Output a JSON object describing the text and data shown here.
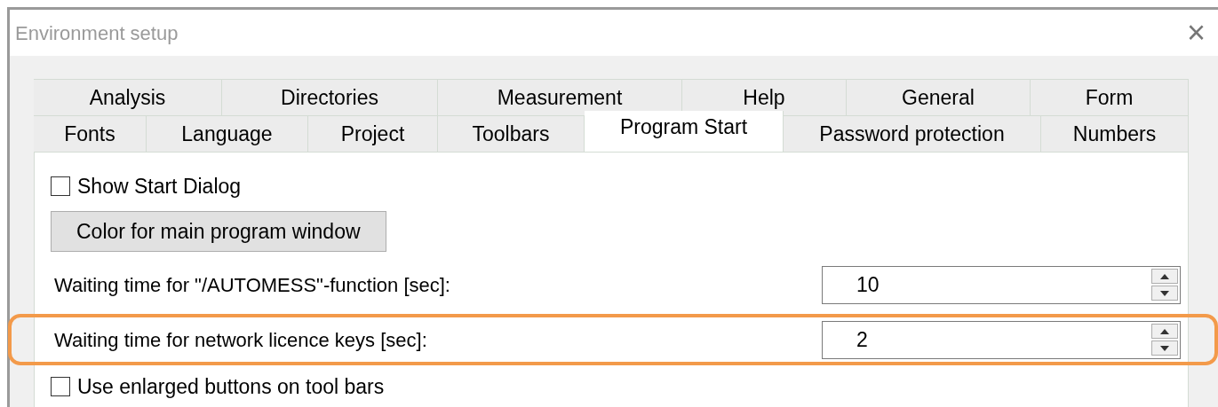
{
  "window": {
    "title": "Environment setup",
    "close": "×"
  },
  "tab_rows": [
    {
      "tabs": [
        {
          "label": "Analysis",
          "selected": false
        },
        {
          "label": "Directories",
          "selected": false
        },
        {
          "label": "Measurement",
          "selected": false
        },
        {
          "label": "Help",
          "selected": false
        },
        {
          "label": "General",
          "selected": false
        },
        {
          "label": "Form",
          "selected": false
        }
      ]
    },
    {
      "tabs": [
        {
          "label": "Fonts",
          "selected": false
        },
        {
          "label": "Language",
          "selected": false
        },
        {
          "label": "Project",
          "selected": false
        },
        {
          "label": "Toolbars",
          "selected": false
        },
        {
          "label": "Program Start",
          "selected": true
        },
        {
          "label": "Password protection",
          "selected": false
        },
        {
          "label": "Numbers",
          "selected": false
        }
      ]
    }
  ],
  "controls": [
    {
      "kind": "checkbox",
      "label": "Show Start Dialog",
      "checked": false
    },
    {
      "kind": "button",
      "label": "Color for main program window"
    },
    {
      "kind": "spinner",
      "label": "Waiting time for \"/AUTOMESS\"-function [sec]:",
      "value": "10",
      "highlighted": false
    },
    {
      "kind": "spinner",
      "label": "Waiting time for network licence keys [sec]:",
      "value": "2",
      "highlighted": true
    },
    {
      "kind": "checkbox",
      "label": "Use enlarged buttons on tool bars",
      "checked": false
    }
  ]
}
